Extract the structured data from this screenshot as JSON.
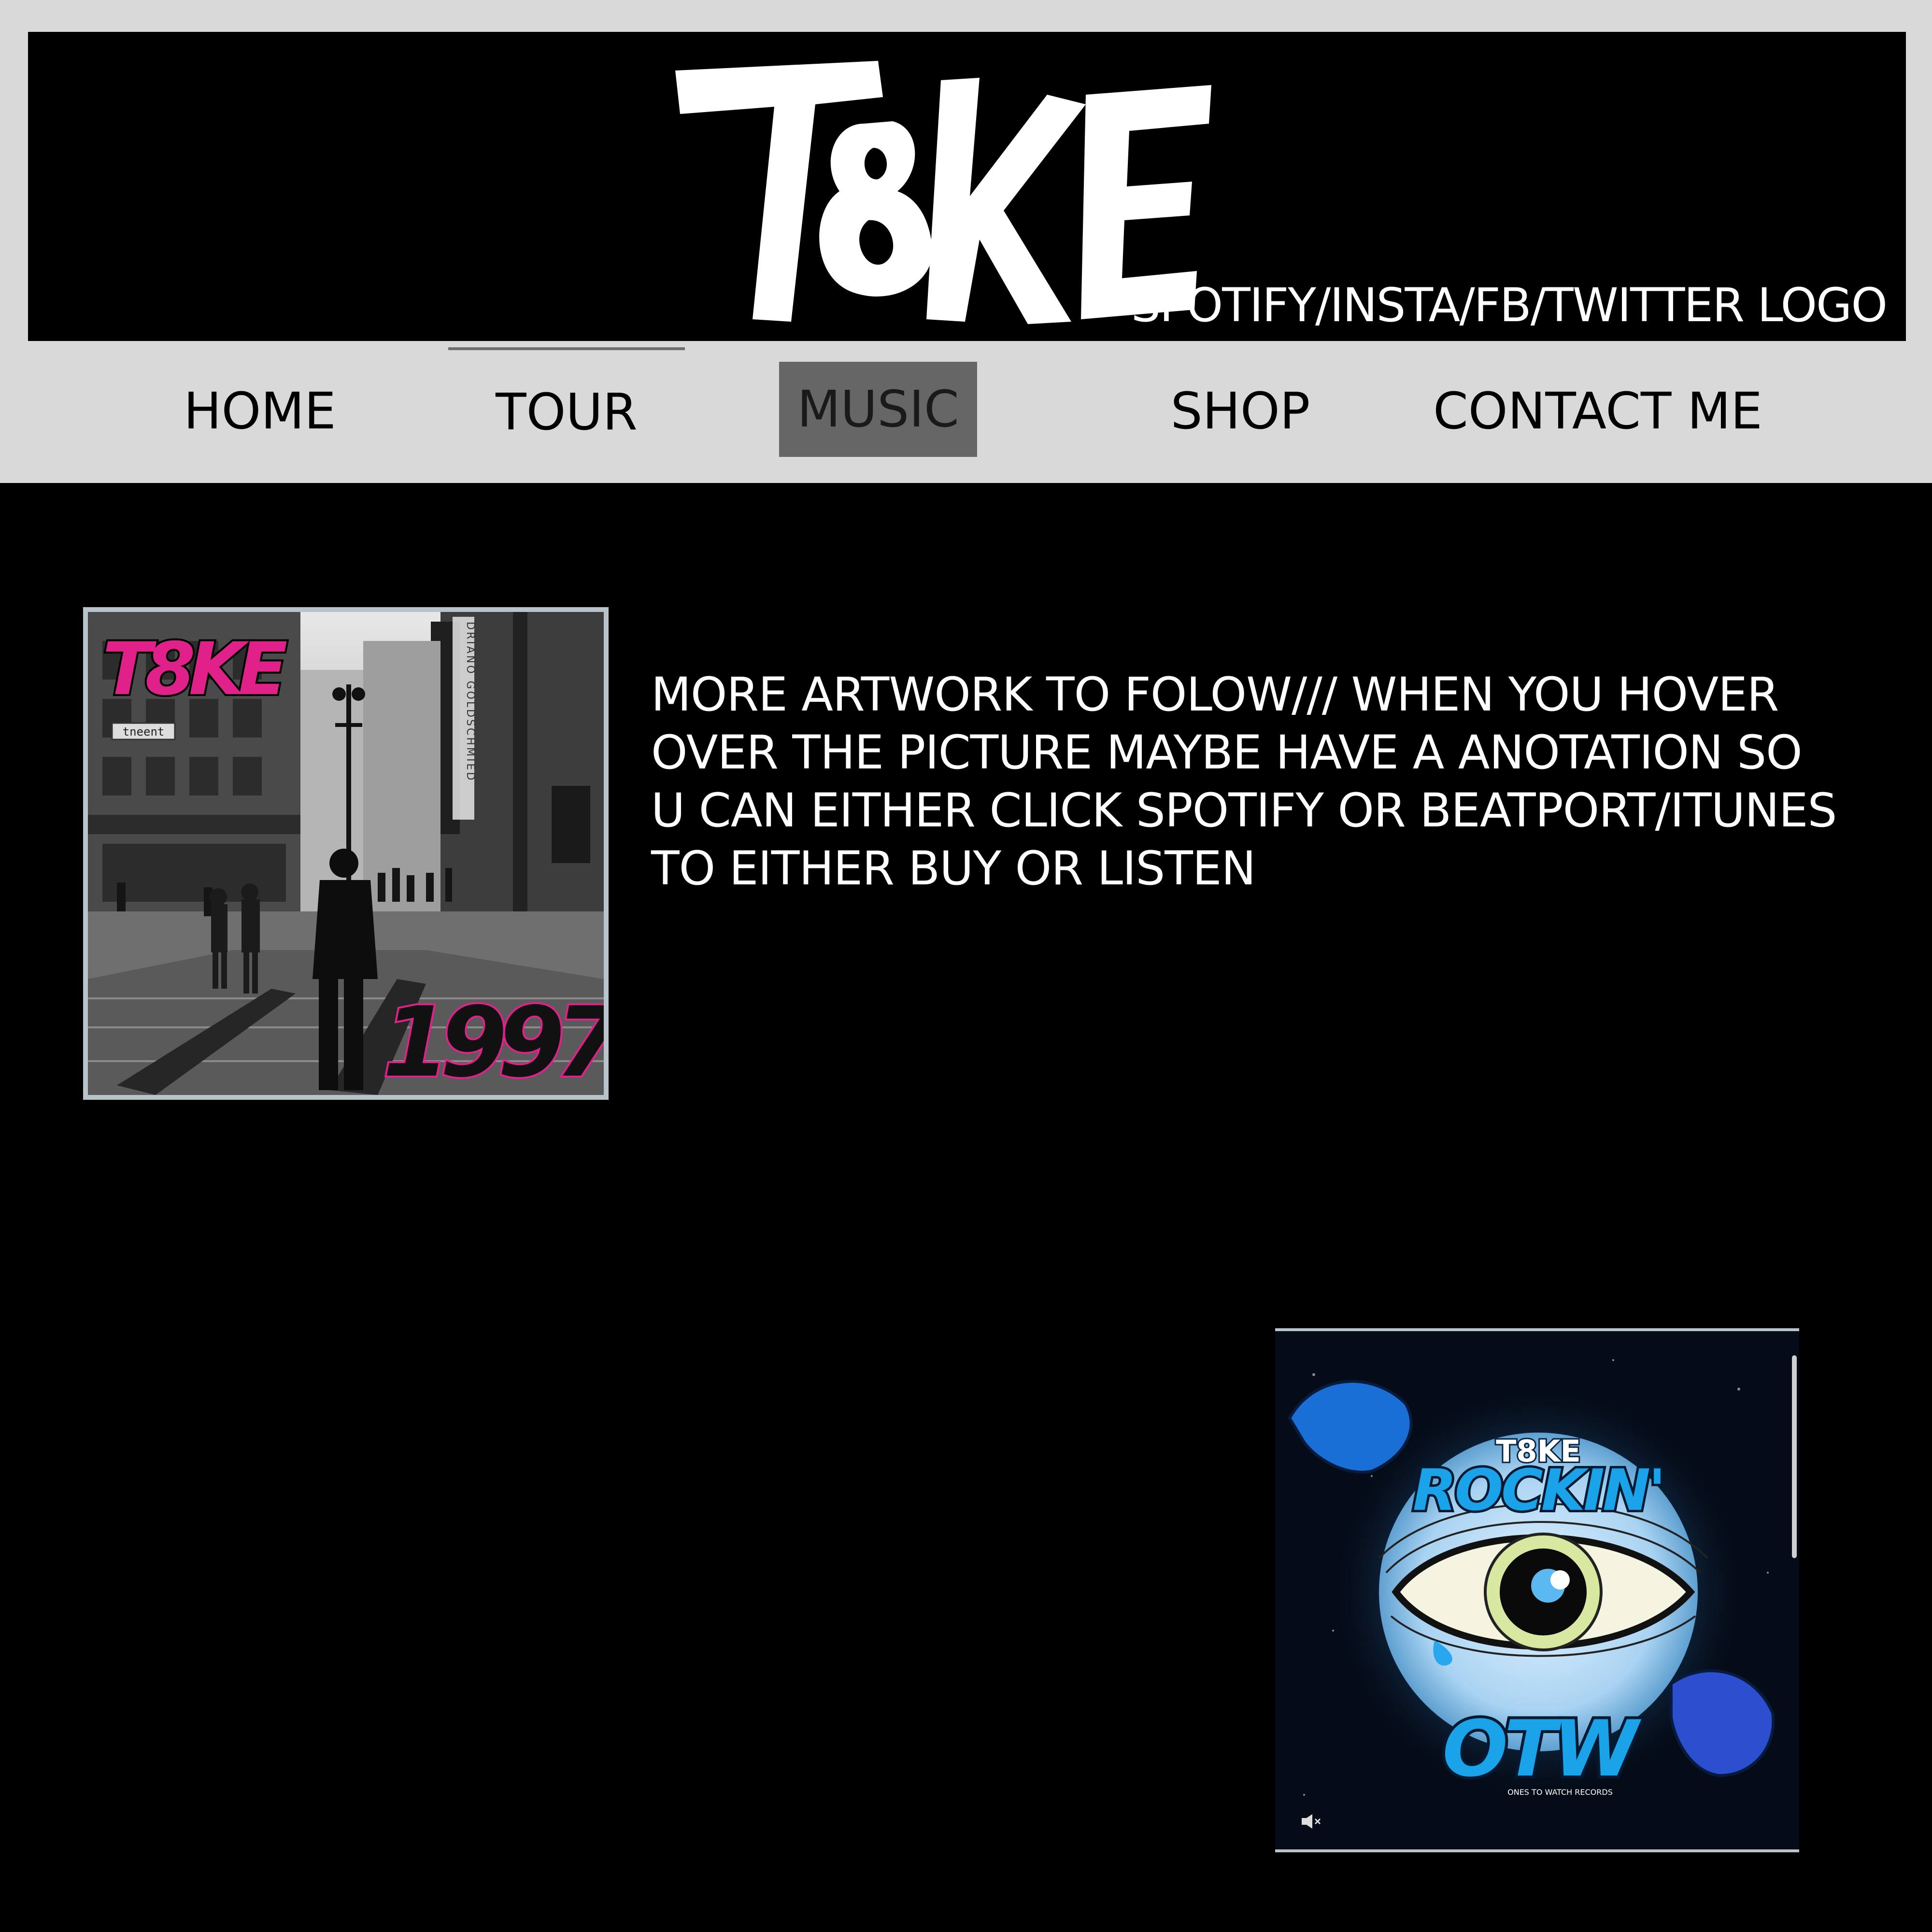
{
  "header": {
    "logo_text": "T8KE",
    "social_placeholder": "SPOTIFY/INSTA/FB/TWITTER LOGO"
  },
  "nav": {
    "items": [
      {
        "label": "HOME"
      },
      {
        "label": "TOUR"
      },
      {
        "label": "MUSIC",
        "active": true
      },
      {
        "label": "SHOP"
      },
      {
        "label": "CONTACT ME"
      }
    ]
  },
  "main": {
    "note": "MORE ARTWORK TO FOLOW/// WHEN YOU HOVER OVER THE PICTURE MAYBE HAVE A ANOTATION SO U CAN EITHER CLICK SPOTIFY OR BEATPORT/ITUNES TO EITHER BUY OR LISTEN",
    "releases": [
      {
        "artist": "T8KE",
        "title": "1997",
        "street_sign": "tneent",
        "banner_text": "DRIANO GOLDSCHMIED",
        "icon": "album-cover-image"
      },
      {
        "artist": "T8KE",
        "title": "ROCKIN'",
        "label_logo": "OTW",
        "label_tagline": "ONES TO WATCH RECORDS",
        "icon": "album-cover-image"
      }
    ]
  },
  "colors": {
    "page_bg": "#000000",
    "band_bg": "#d9d9d9",
    "active_tab": "#666666",
    "cover1_accent": "#e0218a",
    "cover2_accent": "#1aa3e8"
  }
}
